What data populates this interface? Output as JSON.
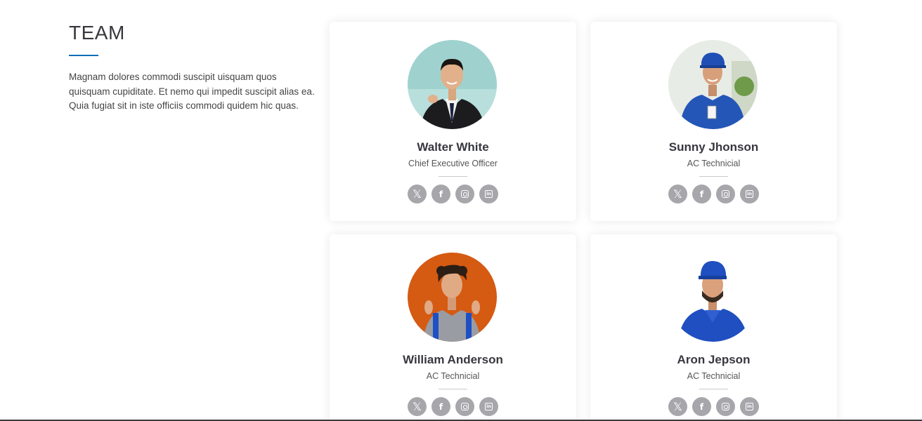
{
  "section": {
    "title": "TEAM",
    "description": "Magnam dolores commodi suscipit uisquam quos quisquam cupiditate. Et nemo qui impedit suscipit alias ea. Quia fugiat sit in iste officiis commodi quidem hic quas."
  },
  "members": [
    {
      "name": "Walter White",
      "role": "Chief Executive Officer"
    },
    {
      "name": "Sunny Jhonson",
      "role": "AC Technicial"
    },
    {
      "name": "William Anderson",
      "role": "AC Technicial"
    },
    {
      "name": "Aron Jepson",
      "role": "AC Technicial"
    }
  ],
  "social_icons": [
    "x-icon",
    "facebook-icon",
    "instagram-icon",
    "linkedin-icon"
  ],
  "colors": {
    "accent": "#106eb5",
    "social_bg": "#a7a6ab",
    "heading": "#37373f"
  }
}
